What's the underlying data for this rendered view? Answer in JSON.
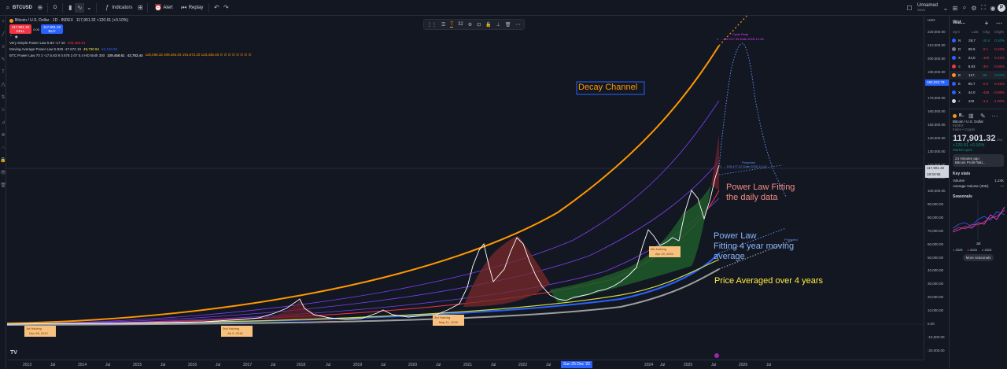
{
  "topbar": {
    "symbol": "BTCUSD",
    "interval": "D",
    "indicators_label": "Indicators",
    "alert_label": "Alert",
    "replay_label": "Replay",
    "layout_name": "Unnamed",
    "layout_sub": "Save",
    "avatar_letter": "P"
  },
  "legend": {
    "title": "Bitcoin / U.S. Dollar · 1D · INDEX",
    "ohlc": "117,901.32 +120.91 (+0.10%)",
    "sell_price": "117,901.32",
    "sell_label": "SELL",
    "spread": "0.00",
    "buy_price": "117,901.32",
    "buy_label": "BUY",
    "indicators": [
      {
        "name": "Very simple Power Law 5.83 -17 10",
        "v1": "109,458.61",
        "v2": "",
        "v3": ""
      },
      {
        "name": "Moving Average Power Law 5.925 -17.672 10",
        "v1": "49,730.94",
        "v2": "52,126.85",
        "v3": ""
      },
      {
        "name": "BTC Power Law 70 2 -17.5.83 8 0.578 2.07 0.4 HD Both 300",
        "v1": "109,458.61",
        "v2": "43,783.44",
        "v3": "118,038.32  209,284.04  191,672.20  123,335.40  ∅ ∅ ∅ ∅ ∅ ∅ ∅ ∅"
      }
    ]
  },
  "float_tools": {
    "width_value": "32"
  },
  "annotations": {
    "decay_channel": "Decay Channel",
    "daily_fit_1": "Power Law Fitting",
    "daily_fit_2": "the daily data",
    "ma_fit_1": "Power Law",
    "ma_fit_2": "Fitting 4 year moving",
    "ma_fit_3": "average",
    "price_avg": "Price Averaged over 4 years",
    "cycle_peak": "Cycle Peak",
    "cycle_peak_detail": "1 → 202,017.35  Date 2025-12-28",
    "projected": "Projected",
    "projected_detail": "1 → 109,477.22  Date 2026-10-12",
    "projected2": "Projected",
    "halving_1": "1st Halving",
    "halving_1_date": "Nov 28, 2012",
    "halving_2": "2nd Halving",
    "halving_2_date": "Jul 9, 2016",
    "halving_3": "3rd Halving",
    "halving_3_date": "May 11, 2020",
    "halving_4": "4th Halving",
    "halving_4_date": "Apr 19, 2024"
  },
  "price_axis": {
    "currency": "USD",
    "labels": [
      "220,000.00",
      "210,000.00",
      "200,000.00",
      "190,000.00",
      "180,000.00",
      "170,000.00",
      "160,000.00",
      "150,000.00",
      "140,000.00",
      "130,000.00",
      "120,000.00",
      "110,000.00",
      "100,000.00",
      "90,000.00",
      "80,000.00",
      "70,000.00",
      "60,000.00",
      "50,000.00",
      "40,000.00",
      "30,000.00",
      "20,000.00",
      "10,000.00",
      "0.00",
      "-10,000.00",
      "-20,000.00"
    ],
    "tag_blue": "182,022.79",
    "tag_price": "117,901.32",
    "tag_countdown": "18:34:56"
  },
  "time_axis": {
    "labels": [
      "2013",
      "Jul",
      "2014",
      "Jul",
      "2015",
      "Jul",
      "2016",
      "Jul",
      "2017",
      "Jul",
      "2018",
      "Jul",
      "2019",
      "Jul",
      "2020",
      "Jul",
      "2021",
      "Jul",
      "2022",
      "Jul",
      "2023",
      "2024",
      "Jul",
      "2025",
      "Jul",
      "2026",
      "Jul"
    ],
    "highlight": "Sun 25 Dec '22"
  },
  "watchlist": {
    "title": "Wat...",
    "cols": [
      "Sym",
      "Last",
      "Chg",
      "Chg%"
    ],
    "rows": [
      {
        "sym": "N",
        "last": "29,7",
        "chg": "40.4",
        "pct": "0.10%",
        "dir": "up",
        "color": "#2962ff"
      },
      {
        "sym": "D",
        "last": "98.5",
        "chg": "-0.1",
        "pct": "-0.10%",
        "dir": "dn",
        "color": "#787b86"
      },
      {
        "sym": "X",
        "last": "24,0",
        "chg": "-100",
        "pct": "-0.42%",
        "dir": "dn",
        "color": "#2962ff"
      },
      {
        "sym": "≡",
        "last": "8,93",
        "chg": "-3%",
        "pct": "-0.66%",
        "dir": "dn",
        "color": "#f23645"
      },
      {
        "sym": "B",
        "last": "117,",
        "chg": "86",
        "pct": "0.07%",
        "dir": "up",
        "color": "#f7931a"
      },
      {
        "sym": "E",
        "last": "95.7",
        "chg": "-0.3",
        "pct": "-0.45%",
        "dir": "dn",
        "color": "#2962ff"
      },
      {
        "sym": "X",
        "last": "44.0",
        "chg": "-436",
        "pct": "-0.98%",
        "dir": "dn",
        "color": "#2962ff"
      },
      {
        "sym": "×",
        "last": "440",
        "chg": "-1.6",
        "pct": "-1.00%",
        "dir": "dn",
        "color": "#d1d4dc"
      }
    ],
    "detail_sym": "B..",
    "detail_name": "Bitcoin / U.S. Dollar",
    "detail_exchange": "INDEX",
    "detail_type": "Index • Crypto",
    "price": "117,901.32",
    "price_unit": "USD",
    "change": "+120.91  +0.10%",
    "market_status": "Market open",
    "news_time": "24 minutes ago",
    "news_title": "Bitcoin Profit-Taki...",
    "key_stats": "Key stats",
    "volume_label": "Volume",
    "volume_value": "1.24K",
    "avg_volume_label": "Average Volume (30D)",
    "avg_volume_value": "—",
    "seasonals": "Seasonals",
    "seasonals_month": "Jul",
    "legend_2025": "2025",
    "legend_2024": "2024",
    "legend_2023": "2023",
    "more_btn": "More seasonals"
  }
}
